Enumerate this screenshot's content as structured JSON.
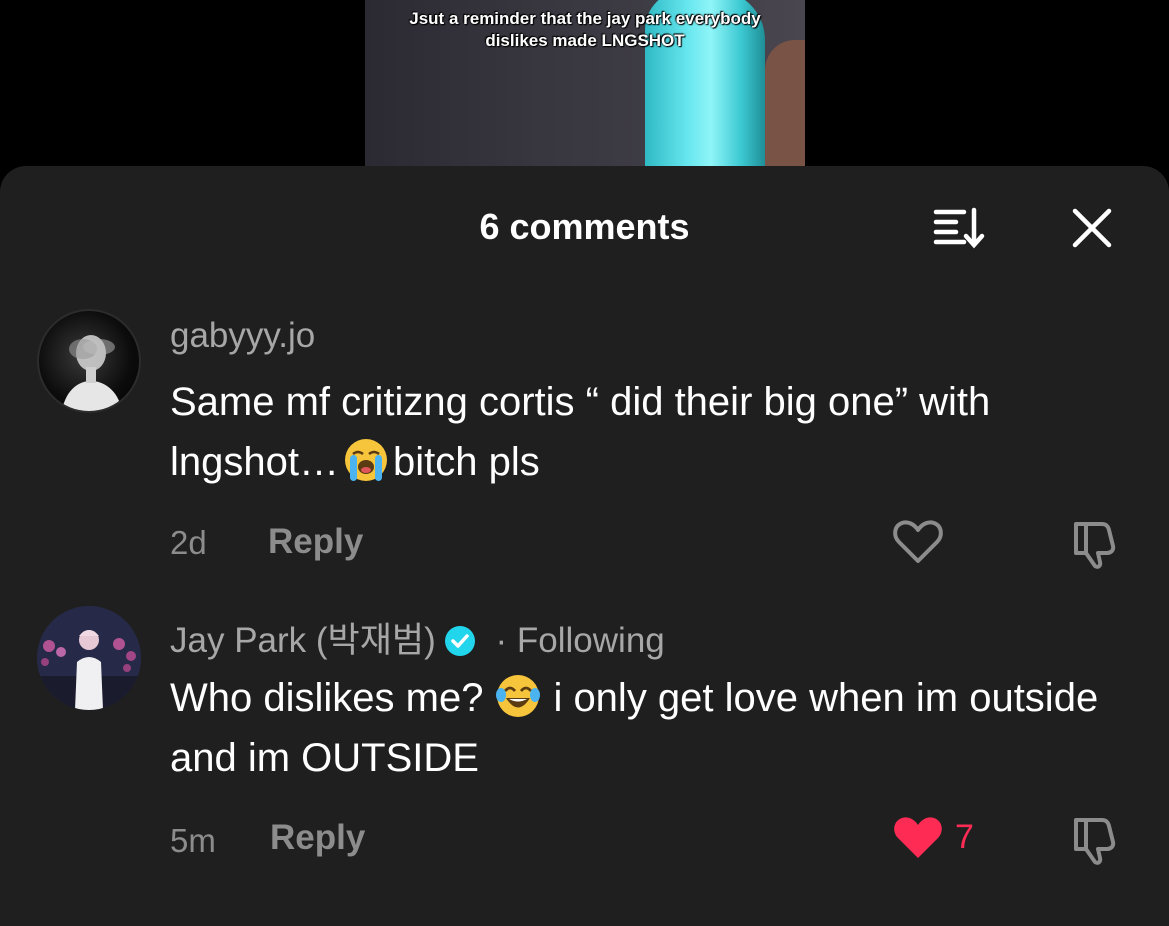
{
  "video": {
    "caption_line1": "Jsut a reminder that the jay park everybody",
    "caption_line2": "dislikes made LNGSHOT"
  },
  "sheet": {
    "title": "6 comments",
    "sort_icon": "sort-icon",
    "close_icon": "close-icon"
  },
  "comments": [
    {
      "username": "gabyyy.jo",
      "text_part1": "Same mf critizng cortis “ did their big one” with lngshot…",
      "emoji": "loudly-crying-emoji",
      "text_part2": "bitch pls",
      "age": "2d",
      "reply_label": "Reply",
      "liked": false,
      "like_count": ""
    },
    {
      "username": "Jay Park (박재범)",
      "verified": true,
      "following_label": "· Following",
      "text_part1": "Who dislikes me?",
      "emoji": "tears-of-joy-emoji",
      "text_part2": "i only get love when im outside and im OUTSIDE",
      "age": "5m",
      "reply_label": "Reply",
      "liked": true,
      "like_count": "7"
    }
  ],
  "colors": {
    "sheet_bg": "#1f1f1f",
    "like_red": "#fe2c55",
    "verified_blue": "#20d5ec",
    "secondary_text": "#a7a7a7"
  }
}
